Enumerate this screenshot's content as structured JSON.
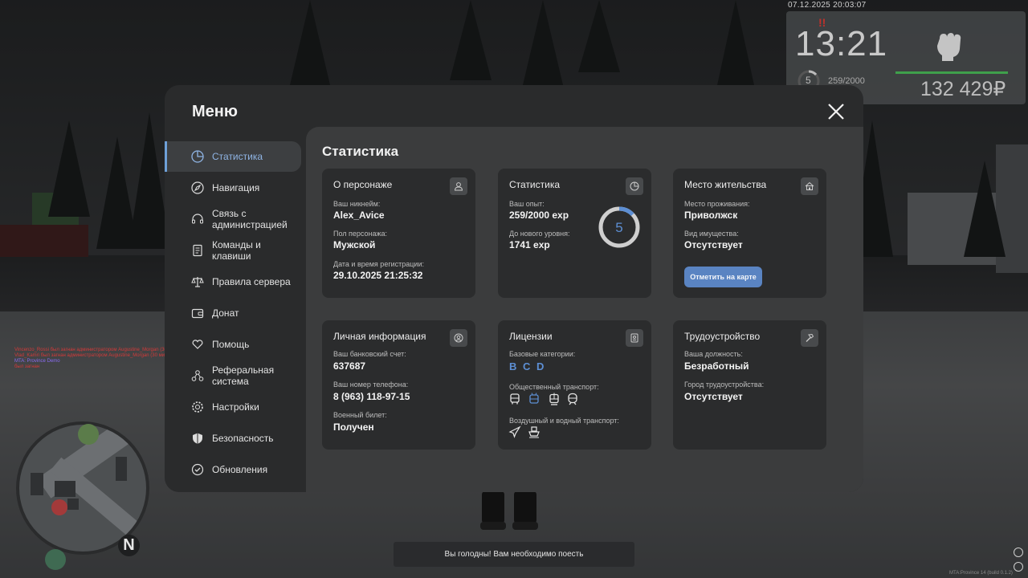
{
  "hud": {
    "datetime": "07.12.2025 20:03:07",
    "alert": "!!",
    "clock": "13:21",
    "level": "5",
    "exp": "259/2000",
    "money": "132 429₽"
  },
  "chat": [
    {
      "text": "Vincenzo_Rossi был загнан администратором Augustine_Morgan (30 мин.) (Caps)",
      "color": "#d33a3a"
    },
    {
      "text": "Vlad_Kamri был загнан администратором Augustine_Morgan (30 мин.) (flood)",
      "color": "#d33a3a"
    },
    {
      "text": "MTA: Province Demo",
      "color": "#8a6cf0"
    },
    {
      "text": "   был загнан",
      "color": "#d33a3a"
    }
  ],
  "notice": "Вы голодны! Вам необходимо поесть",
  "build_info": "MTA:Province 14 (build 0.1.2)",
  "menu": {
    "title": "Меню",
    "sidebar": [
      {
        "label": "Статистика",
        "icon": "pie-chart-icon",
        "active": true
      },
      {
        "label": "Навигация",
        "icon": "compass-icon"
      },
      {
        "label": "Связь с администрацией",
        "icon": "headset-icon"
      },
      {
        "label": "Команды и клавиши",
        "icon": "document-icon"
      },
      {
        "label": "Правила сервера",
        "icon": "scales-icon"
      },
      {
        "label": "Донат",
        "icon": "wallet-icon"
      },
      {
        "label": "Помощь",
        "icon": "heart-hand-icon"
      },
      {
        "label": "Реферальная система",
        "icon": "network-icon"
      },
      {
        "label": "Настройки",
        "icon": "gear-icon"
      },
      {
        "label": "Безопасность",
        "icon": "shield-icon"
      },
      {
        "label": "Обновления",
        "icon": "check-circle-icon"
      }
    ],
    "content": {
      "title": "Статистика",
      "character": {
        "heading": "О персонаже",
        "nickname_label": "Ваш никнейм:",
        "nickname": "Alex_Avice",
        "gender_label": "Пол персонажа:",
        "gender": "Мужской",
        "reg_label": "Дата и время регистрации:",
        "reg": "29.10.2025 21:25:32"
      },
      "stats": {
        "heading": "Статистика",
        "exp_label": "Ваш опыт:",
        "exp": "259/2000 exp",
        "next_label": "До нового уровня:",
        "next": "1741 exp",
        "level": "5",
        "progress": 0.1295
      },
      "residence": {
        "heading": "Место жительства",
        "place_label": "Место проживания:",
        "place": "Приволжск",
        "property_label": "Вид имущества:",
        "property": "Отсутствует",
        "button": "Отметить на карте"
      },
      "personal": {
        "heading": "Личная информация",
        "bank_label": "Ваш банковский счет:",
        "bank": "637687",
        "phone_label": "Ваш номер телефона:",
        "phone": "8 (963) 118-97-15",
        "military_label": "Военный билет:",
        "military": "Получен"
      },
      "licenses": {
        "heading": "Лицензии",
        "basic_label": "Базовые категории:",
        "categories": [
          "B",
          "C",
          "D"
        ],
        "public_label": "Общественный транспорт:",
        "public": [
          "bus-icon",
          "trolleybus-icon",
          "tram-icon",
          "train-icon"
        ],
        "air_label": "Воздушный и водный транспорт:",
        "air": [
          "plane-icon",
          "boat-icon"
        ]
      },
      "employment": {
        "heading": "Трудоустройство",
        "position_label": "Ваша должность:",
        "position": "Безработный",
        "city_label": "Город трудоустройства:",
        "city": "Отсутствует"
      }
    }
  },
  "colors": {
    "accent": "#5a84c2",
    "active_text": "#8fb4e4",
    "panel": "#2a2b2c",
    "content": "#3b3c3d",
    "card": "#2b2c2d",
    "license": "#5d8fd4"
  }
}
